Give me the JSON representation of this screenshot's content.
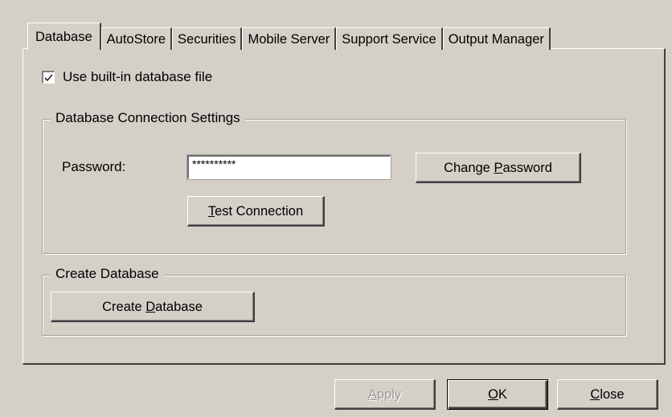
{
  "tabs": [
    {
      "label": "Database",
      "active": true
    },
    {
      "label": "AutoStore",
      "active": false
    },
    {
      "label": "Securities",
      "active": false
    },
    {
      "label": "Mobile Server",
      "active": false
    },
    {
      "label": "Support Service",
      "active": false
    },
    {
      "label": "Output Manager",
      "active": false
    }
  ],
  "use_builtin": {
    "label": "Use built-in database file",
    "checked": true
  },
  "connection_group": {
    "title": "Database Connection Settings",
    "password_label": "Password:",
    "password_value": "**********",
    "change_password": {
      "before": "Change ",
      "mnemonic": "P",
      "after": "assword"
    },
    "test_connection": {
      "before": "",
      "mnemonic": "T",
      "after": "est Connection"
    }
  },
  "create_group": {
    "title": "Create Database",
    "create_button": {
      "before": "Create ",
      "mnemonic": "D",
      "after": "atabase"
    }
  },
  "footer": {
    "apply": {
      "before": "",
      "mnemonic": "A",
      "after": "pply",
      "enabled": false
    },
    "ok": {
      "before": "",
      "mnemonic": "O",
      "after": "K"
    },
    "close": {
      "before": "",
      "mnemonic": "C",
      "after": "lose"
    }
  },
  "colors": {
    "face": "#d4d0c8",
    "highlight": "#ffffff",
    "shadow": "#404040",
    "disabled_text": "#9c9a94"
  }
}
